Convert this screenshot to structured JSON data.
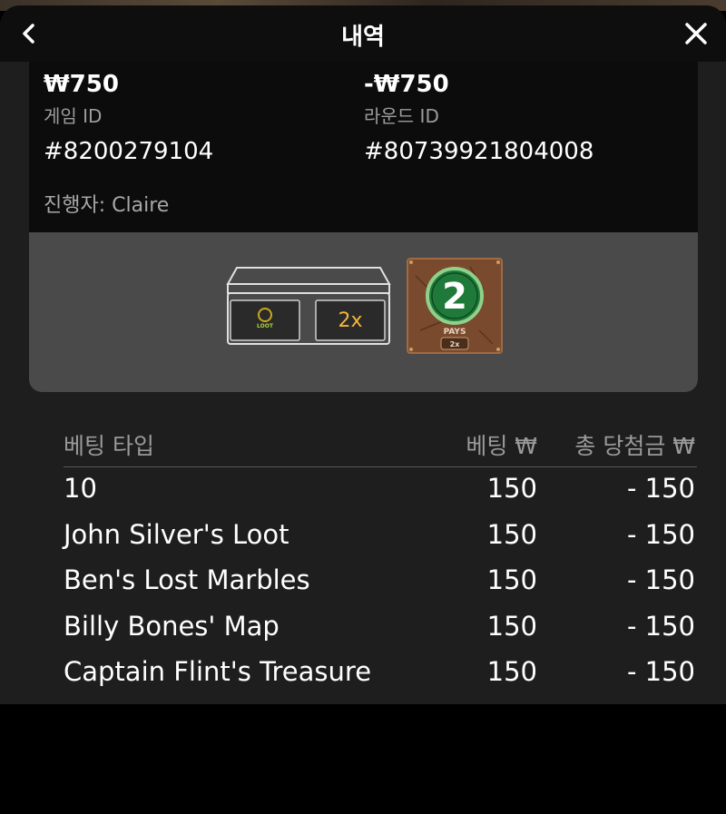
{
  "header": {
    "title": "내역",
    "back_icon": "chevron-left-icon",
    "close_icon": "close-icon"
  },
  "summary": {
    "bet_amount": "₩750",
    "net_amount": "-₩750",
    "game_id_label": "게임 ID",
    "game_id": "#8200279104",
    "round_id_label": "라운드 ID",
    "round_id": "#80739921804008",
    "dealer": "진행자: Claire"
  },
  "result": {
    "chest_logo": "JOHN SILVER'S LOOT",
    "multiplier": "2x",
    "tile_number": "2",
    "tile_caption": "PAYS",
    "tile_multiplier": "2x"
  },
  "table": {
    "headers": {
      "type": "베팅 타입",
      "bet": "베팅 ₩",
      "win": "총 당첨금 ₩"
    },
    "rows": [
      {
        "type": "10",
        "bet": "150",
        "win": "- 150"
      },
      {
        "type": "John Silver's Loot",
        "bet": "150",
        "win": "- 150"
      },
      {
        "type": "Ben's Lost Marbles",
        "bet": "150",
        "win": "- 150"
      },
      {
        "type": "Billy Bones' Map",
        "bet": "150",
        "win": "- 150"
      },
      {
        "type": "Captain Flint's Treasure",
        "bet": "150",
        "win": "- 150"
      }
    ]
  },
  "colors": {
    "panel_bg": "#1e1e1e",
    "header_bg": "#0e0e0e",
    "result_bg": "#4a4a4a",
    "tile_green": "#1f7a3a",
    "tile_brown": "#7a4a2e"
  }
}
